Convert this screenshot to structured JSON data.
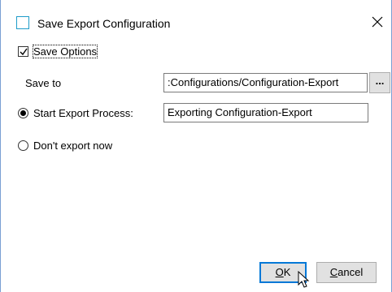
{
  "window": {
    "title": "Save Export Configuration",
    "close_icon": "close-icon",
    "title_icon": "window-icon",
    "accent_color": "#0078d7"
  },
  "save_options": {
    "label": "Save Options",
    "checked": true
  },
  "save_to": {
    "label": "Save to",
    "value": ":Configurations/Configuration-Export",
    "browse_label": "..."
  },
  "start_export": {
    "label": "Start Export Process:",
    "selected": true,
    "value": "Exporting Configuration-Export"
  },
  "dont_export": {
    "label": "Don't export now",
    "selected": false
  },
  "buttons": {
    "ok_label": "OK",
    "ok_mnemonic": "O",
    "ok_rest": "K",
    "cancel_label": "Cancel",
    "cancel_mnemonic": "C",
    "cancel_rest": "ancel"
  }
}
